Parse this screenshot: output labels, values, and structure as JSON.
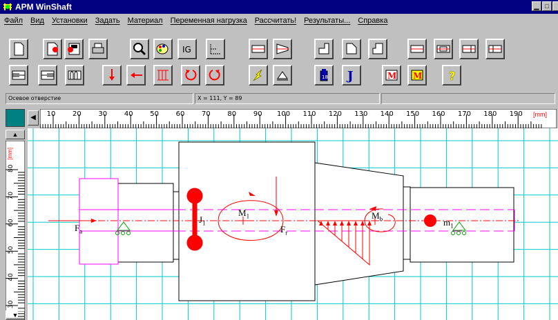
{
  "window": {
    "title": "APM WinShaft"
  },
  "menu": [
    "Файл",
    "Вид",
    "Установки",
    "Задать",
    "Материал",
    "Переменная нагрузка",
    "Рассчитать!",
    "Результаты...",
    "Справка"
  ],
  "toolbar_row1_icons": [
    "new-doc-icon",
    "save-icon",
    "save-as-icon",
    "print-icon",
    "zoom-icon",
    "palette-icon",
    "grid-snap-icon",
    "move-icon",
    "segment-cylinder-icon",
    "segment-cone-icon",
    "shoulder-left-icon",
    "chamfer-icon",
    "shoulder-right-icon",
    "groove-1-icon",
    "groove-2-icon",
    "groove-3-icon",
    "groove-4-icon"
  ],
  "toolbar_row2_icons": [
    "hole-icon",
    "bore-icon",
    "spline-icon",
    "radial-force-icon",
    "axial-force-icon",
    "distributed-load-icon",
    "moment-ccw-icon",
    "moment-cw-icon",
    "lightning-icon",
    "support-icon",
    "bearing-icon",
    "inertia-icon",
    "material-m-icon",
    "material-m2-icon",
    "help-icon"
  ],
  "status": {
    "mode": "Осевое отверстие",
    "coords": "X = 111, Y = 89"
  },
  "ruler_h": {
    "unit": "[mm]",
    "ticks": [
      "10",
      "20",
      "30",
      "40",
      "50",
      "60",
      "70",
      "80",
      "90",
      "100",
      "110",
      "120",
      "130",
      "140",
      "150",
      "160",
      "170",
      "180",
      "190"
    ]
  },
  "ruler_v": {
    "unit": "[mm]",
    "ticks": [
      "80",
      "70",
      "60",
      "50",
      "40",
      "30"
    ]
  },
  "labels": {
    "fa": "F",
    "fa_sub": "a",
    "j1": "J",
    "j1_sub": "1",
    "m1": "M",
    "m1_sub": "1",
    "fr": "F",
    "fr_sub": "r",
    "mb": "M",
    "mb_sub": "b",
    "mr1": "m",
    "mr1_sub": "1"
  },
  "colors": {
    "title_bg": "#000080",
    "shaft_line": "#000000",
    "load": "#ff0000",
    "axis_magenta": "#ff00ff",
    "grid": "#00c8c8"
  }
}
